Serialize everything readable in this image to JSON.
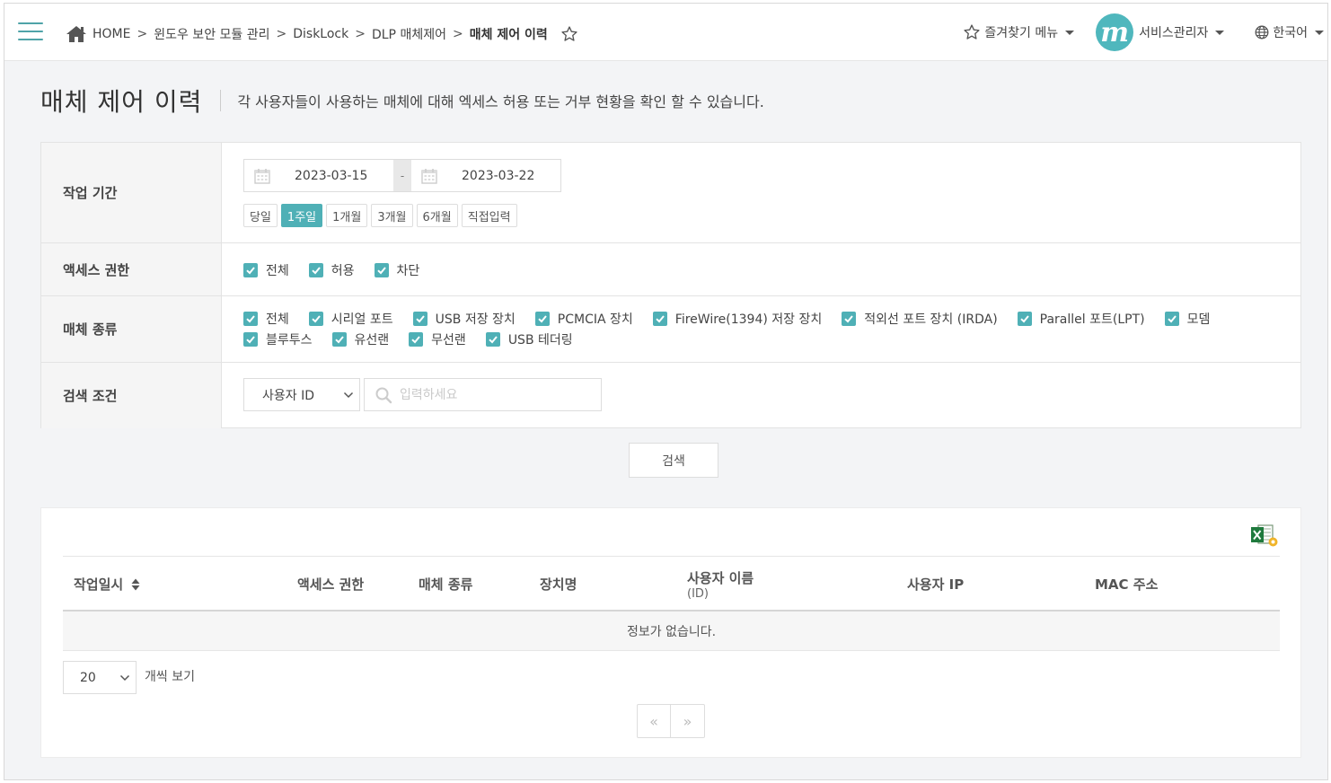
{
  "breadcrumb": {
    "home": "HOME",
    "sep": ">",
    "items": [
      "윈도우 보안 모듈 관리",
      "DiskLock",
      "DLP 매체제어"
    ],
    "current": "매체 제어 이력"
  },
  "topbar": {
    "favorites_label": "즐겨찾기 메뉴",
    "avatar_letter": "m",
    "user_label": "서비스관리자",
    "language_label": "한국어",
    "accent_color": "#4fb7bd"
  },
  "page": {
    "title": "매체 제어 이력",
    "description": "각 사용자들이 사용하는 매체에 대해 엑세스 허용 또는 거부 현황을 확인 할 수 있습니다."
  },
  "filters": {
    "period": {
      "label": "작업 기간",
      "start_date": "2023-03-15",
      "end_date": "2023-03-22",
      "separator": "-",
      "buttons": [
        "당일",
        "1주일",
        "1개월",
        "3개월",
        "6개월",
        "직접입력"
      ],
      "active": "1주일"
    },
    "access": {
      "label": "액세스 권한",
      "options": [
        "전체",
        "허용",
        "차단"
      ]
    },
    "media": {
      "label": "매체 종류",
      "options": [
        "전체",
        "시리얼 포트",
        "USB 저장 장치",
        "PCMCIA 장치",
        "FireWire(1394) 저장 장치",
        "적외선 포트 장치 (IRDA)",
        "Parallel 포트(LPT)",
        "모뎀",
        "블루투스",
        "유선랜",
        "무선랜",
        "USB 테더링"
      ]
    },
    "search": {
      "label": "검색 조건",
      "select_value": "사용자 ID",
      "placeholder": "입력하세요"
    }
  },
  "search_button": "검색",
  "table": {
    "columns": [
      {
        "label": "작업일시",
        "sub": ""
      },
      {
        "label": "액세스 권한",
        "sub": ""
      },
      {
        "label": "매체 종류",
        "sub": ""
      },
      {
        "label": "장치명",
        "sub": ""
      },
      {
        "label": "사용자 이름",
        "sub": "(ID)"
      },
      {
        "label": "사용자 IP",
        "sub": ""
      },
      {
        "label": "MAC 주소",
        "sub": ""
      }
    ],
    "empty_message": "정보가 없습니다."
  },
  "pagination": {
    "page_size": "20",
    "page_size_label": "개씩 보기",
    "prev": "«",
    "next": "»"
  }
}
